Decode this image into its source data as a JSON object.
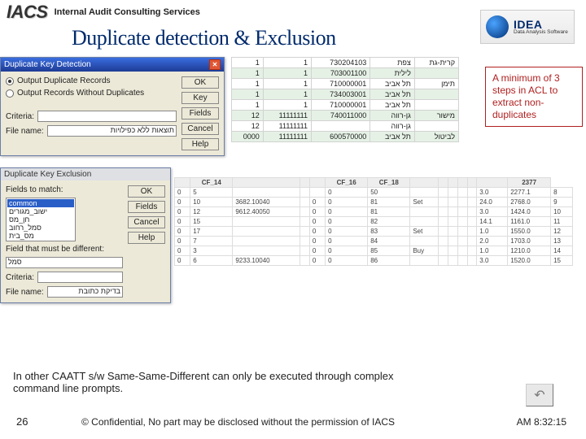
{
  "header": {
    "brand": "IACS",
    "tagline": "Internal Audit Consulting Services"
  },
  "title": "Duplicate detection & Exclusion",
  "idea": {
    "name": "IDEA",
    "sub": "Data Analysis Software"
  },
  "callout": "A minimum of 3 steps in ACL to extract non-duplicates",
  "dlg1": {
    "title": "Duplicate Key Detection",
    "opt1": "Output Duplicate Records",
    "opt2": "Output Records Without Duplicates",
    "criteria_label": "Criteria:",
    "filename_label": "File name:",
    "filename_value": "תוצאות ללא כפילויות",
    "btn_ok": "OK",
    "btn_key": "Key",
    "btn_fields": "Fields",
    "btn_cancel": "Cancel",
    "btn_help": "Help"
  },
  "dlg2": {
    "title": "Duplicate Key Exclusion",
    "fields_label": "Fields to match:",
    "fields": [
      "common",
      "ישוב_מגורים",
      "חן_מס",
      "סמל_רחוב",
      "מס_בית"
    ],
    "diff_label": "Field that must be different:",
    "diff_value": "סמל",
    "criteria_label": "Criteria:",
    "filename_label": "File name:",
    "filename_value": "בדיקת כתובת",
    "btn_ok": "OK",
    "btn_fields": "Fields",
    "btn_cancel": "Cancel",
    "btn_help": "Help"
  },
  "table1": {
    "rows": [
      [
        "1",
        "1",
        "730204103",
        "צפת",
        "קרית-גת"
      ],
      [
        "1",
        "1",
        "703001100",
        "לילית",
        ""
      ],
      [
        "1",
        "1",
        "710000001",
        "תל אביב",
        "תימן"
      ],
      [
        "1",
        "1",
        "734003001",
        "תל אביב",
        ""
      ],
      [
        "1",
        "1",
        "710000001",
        "תל אביב",
        ""
      ],
      [
        "12",
        "11111111",
        "740011000",
        "גן-רווה",
        "מישור"
      ],
      [
        "12",
        "11111111",
        "",
        "גן-רווה",
        ""
      ],
      [
        "0000",
        "11111111",
        "600570000",
        "תל אביב",
        "לביטול"
      ]
    ]
  },
  "lowband": {
    "headers": [
      "",
      "CF_14",
      "",
      "",
      "",
      "CF_16",
      "CF_18",
      "",
      "",
      "",
      "",
      "",
      "",
      "2377"
    ],
    "rows": [
      [
        "0",
        "5",
        "",
        "",
        "",
        "0",
        "50",
        "",
        "",
        "",
        "",
        "",
        "3.0",
        "2277.1",
        "8"
      ],
      [
        "0",
        "10",
        "3682.10040",
        "",
        "0",
        "0",
        "81",
        "Set",
        "",
        "",
        "",
        "",
        "24.0",
        "2768.0",
        "9"
      ],
      [
        "0",
        "12",
        "9612.40050",
        "",
        "0",
        "0",
        "81",
        "",
        "",
        "",
        "",
        "",
        "3.0",
        "1424.0",
        "10"
      ],
      [
        "0",
        "15",
        "",
        "",
        "0",
        "0",
        "82",
        "",
        "",
        "",
        "",
        "",
        "14.1",
        "1161.0",
        "11"
      ],
      [
        "0",
        "17",
        "",
        "",
        "0",
        "0",
        "83",
        "Set",
        "",
        "",
        "",
        "",
        "1.0",
        "1550.0",
        "12"
      ],
      [
        "0",
        "7",
        "",
        "",
        "0",
        "0",
        "84",
        "",
        "",
        "",
        "",
        "",
        "2.0",
        "1703.0",
        "13"
      ],
      [
        "0",
        "3",
        "",
        "",
        "0",
        "0",
        "85",
        "Buy",
        "",
        "",
        "",
        "",
        "1.0",
        "1210.0",
        "14"
      ],
      [
        "0",
        "6",
        "9233.10040",
        "",
        "0",
        "0",
        "86",
        "",
        "",
        "",
        "",
        "",
        "3.0",
        "1520.0",
        "15"
      ]
    ]
  },
  "footer": "In other CAATT s/w Same-Same-Different can only be executed through complex command line prompts.",
  "page": "26",
  "copyright": "© Confidential, No part may be disclosed without the permission of IACS",
  "clock": "AM 8:32:15"
}
